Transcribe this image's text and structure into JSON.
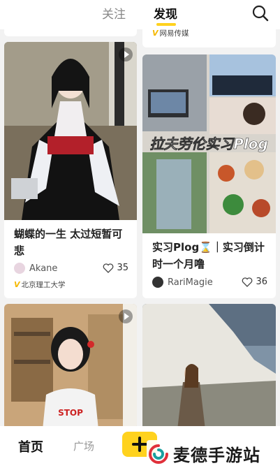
{
  "header": {
    "tabs": [
      {
        "label": "关注"
      },
      {
        "label": "发现"
      }
    ]
  },
  "feed": {
    "top_partial_badge": "网易传媒",
    "cards": [
      {
        "title_line1": "蝴蝶的一生 太过短暂可",
        "title_line2": "悲",
        "author": "Akane",
        "likes": "35",
        "badge": "北京理工大学",
        "is_video": true
      },
      {
        "image_overlay": "拉夫劳伦实习Plog",
        "title_line1": "实习Plog⌛｜实习倒计",
        "title_line2": "时一个月噜",
        "author": "RariMagie",
        "likes": "36"
      },
      {
        "image_text": "STOP",
        "is_video": true
      },
      {}
    ]
  },
  "bottom_nav": {
    "home": "首页",
    "square": "广场",
    "add_icon": "plus-icon"
  },
  "watermark": {
    "text": "麦德手游站"
  },
  "colors": {
    "accent": "#ffd21e",
    "text": "#222222",
    "muted": "#888888"
  }
}
